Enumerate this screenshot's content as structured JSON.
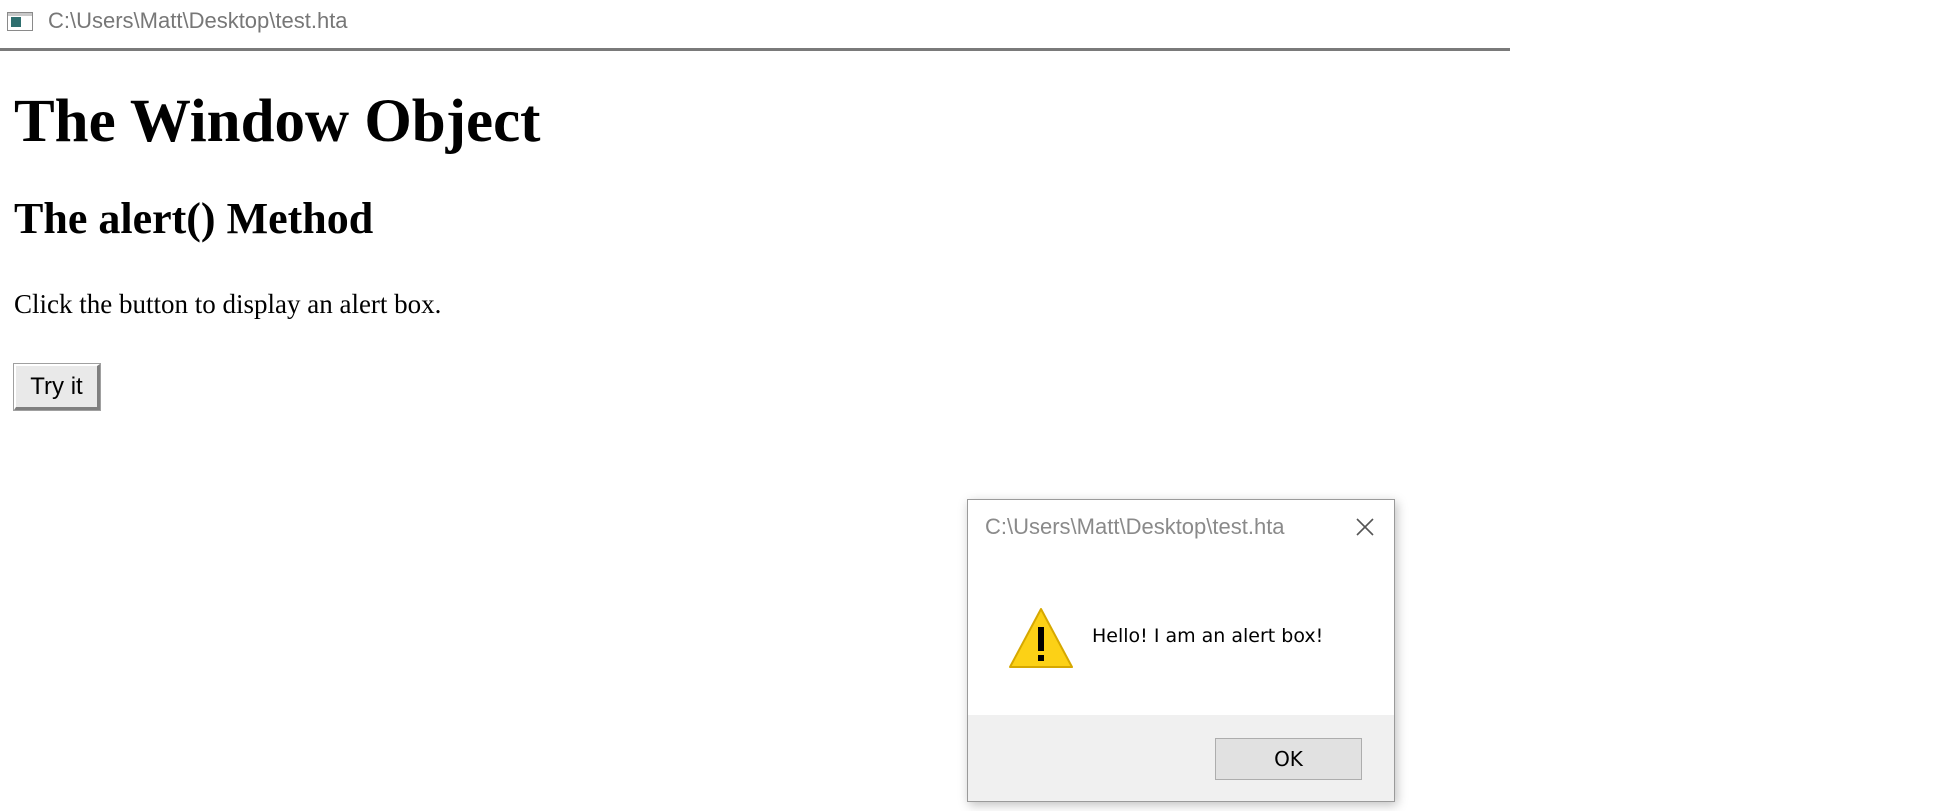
{
  "window": {
    "title": "C:\\Users\\Matt\\Desktop\\test.hta",
    "icon": "hta-window-icon"
  },
  "document": {
    "heading": "The Window Object",
    "subheading": "The alert() Method",
    "paragraph": "Click the button to display an alert box.",
    "button_label": "Try it"
  },
  "alert_dialog": {
    "title": "C:\\Users\\Matt\\Desktop\\test.hta",
    "message": "Hello! I am an alert box!",
    "ok_label": "OK",
    "close_icon": "close-icon",
    "warning_icon": "warning-icon",
    "colors": {
      "warning_fill": "#fcd116",
      "footer_bg": "#f0f0f0"
    }
  }
}
